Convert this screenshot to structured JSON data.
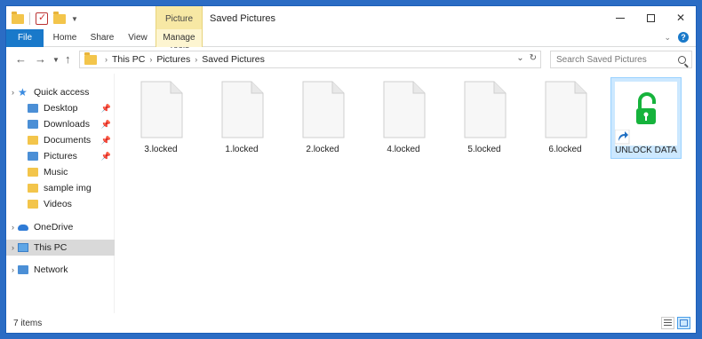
{
  "window": {
    "title": "Saved Pictures",
    "context_tab": "Picture Tools"
  },
  "ribbon": {
    "tabs": [
      {
        "label": "File"
      },
      {
        "label": "Home"
      },
      {
        "label": "Share"
      },
      {
        "label": "View"
      },
      {
        "label": "Manage"
      }
    ]
  },
  "address": {
    "breadcrumbs": [
      "This PC",
      "Pictures",
      "Saved Pictures"
    ]
  },
  "search": {
    "placeholder": "Search Saved Pictures"
  },
  "sidebar": {
    "items": [
      {
        "label": "Quick access",
        "icon": "quick-access-icon"
      },
      {
        "label": "Desktop",
        "icon": "desktop-folder-icon",
        "pinned": true
      },
      {
        "label": "Downloads",
        "icon": "downloads-folder-icon",
        "pinned": true
      },
      {
        "label": "Documents",
        "icon": "documents-folder-icon",
        "pinned": true
      },
      {
        "label": "Pictures",
        "icon": "pictures-folder-icon",
        "pinned": true
      },
      {
        "label": "Music",
        "icon": "music-folder-icon"
      },
      {
        "label": "sample img",
        "icon": "folder-icon"
      },
      {
        "label": "Videos",
        "icon": "videos-folder-icon"
      },
      {
        "label": "OneDrive",
        "icon": "onedrive-icon"
      },
      {
        "label": "This PC",
        "icon": "this-pc-icon",
        "selected": true
      },
      {
        "label": "Network",
        "icon": "network-icon"
      }
    ]
  },
  "files": [
    {
      "name": "3.locked"
    },
    {
      "name": "1.locked"
    },
    {
      "name": "2.locked"
    },
    {
      "name": "4.locked"
    },
    {
      "name": "5.locked"
    },
    {
      "name": "6.locked"
    },
    {
      "name": "UNLOCK DATA",
      "type": "shortcut"
    }
  ],
  "status": {
    "count": "7 items"
  },
  "colors": {
    "accent": "#1979ca",
    "context_tab": "#f7e8a4",
    "selection": "#cce8ff",
    "unlock_icon": "#16b33c"
  }
}
